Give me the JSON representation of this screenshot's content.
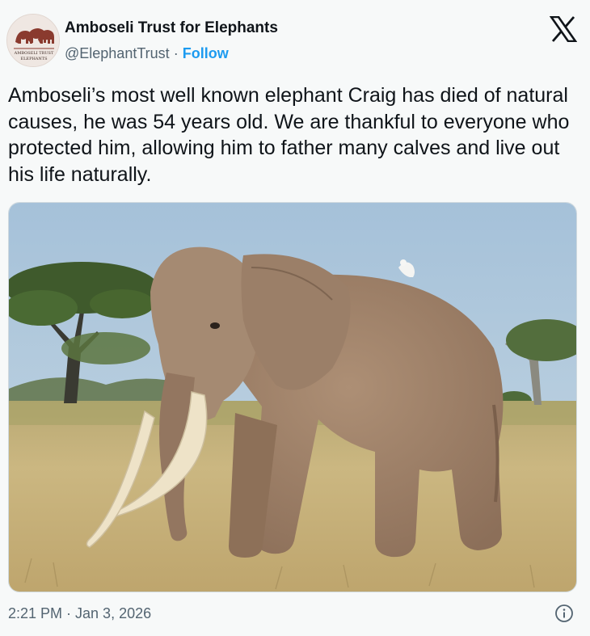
{
  "author": {
    "name": "Amboseli Trust for Elephants",
    "handle": "@ElephantTrust",
    "separator": "·",
    "follow_label": "Follow",
    "avatar_logo_text": [
      "AMBOSELI TRUST",
      "ELEPHANTS"
    ]
  },
  "tweet": {
    "text": "Amboseli’s most well known elephant Craig has died of natural causes, he was 54 years old. We are thankful to everyone who protected him, allowing him to father many calves and live out his life naturally."
  },
  "media": {
    "subject": "elephant-photo",
    "colors": {
      "sky": "#a9c3d8",
      "grass": "#c9b37b",
      "elephant": "#a0826a",
      "tusk": "#efe6cf"
    }
  },
  "footer": {
    "timestamp": "2:21 PM · Jan 3, 2026",
    "info_icon": "info-icon"
  },
  "branding": {
    "logo_icon": "x-logo-icon",
    "accent": "#1d9bf0"
  }
}
